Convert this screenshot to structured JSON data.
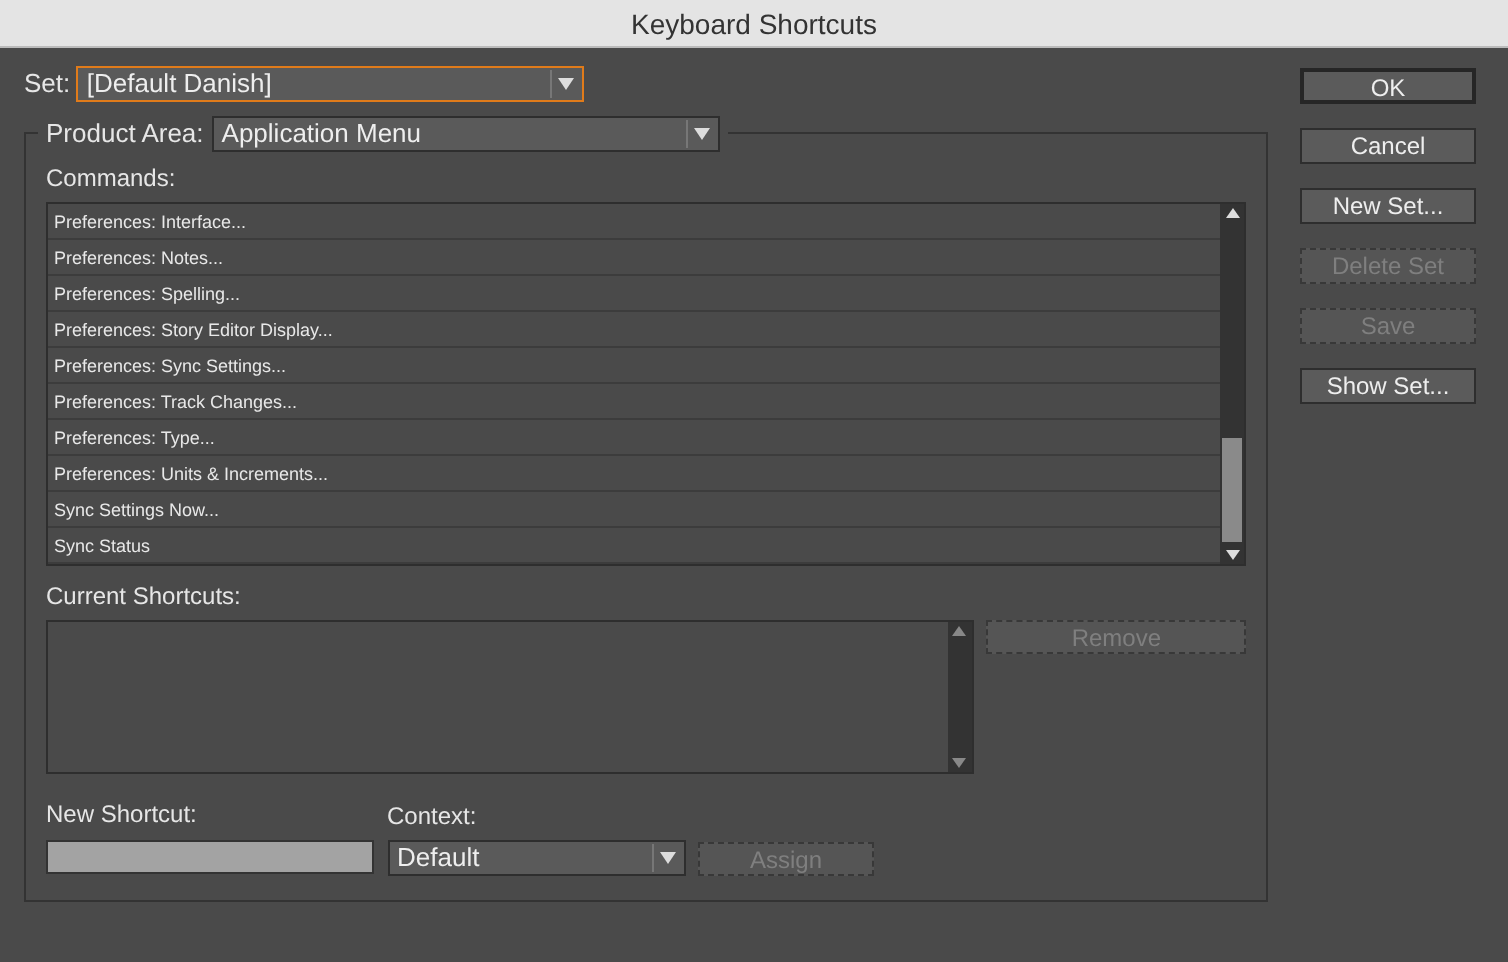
{
  "window": {
    "title": "Keyboard Shortcuts"
  },
  "set": {
    "label": "Set:",
    "value": "[Default Danish]",
    "focused": true
  },
  "product_area": {
    "label": "Product Area:",
    "value": "Application Menu"
  },
  "commands": {
    "label": "Commands:",
    "items": [
      {
        "text": "Preferences: Interface...",
        "selected": false
      },
      {
        "text": "Preferences: Notes...",
        "selected": false
      },
      {
        "text": "Preferences: Spelling...",
        "selected": false
      },
      {
        "text": "Preferences: Story Editor Display...",
        "selected": false
      },
      {
        "text": "Preferences: Sync Settings...",
        "selected": false
      },
      {
        "text": "Preferences: Track Changes...",
        "selected": false
      },
      {
        "text": "Preferences: Type...",
        "selected": false
      },
      {
        "text": "Preferences: Units & Increments...",
        "selected": false
      },
      {
        "text": "Sync Settings Now...",
        "selected": false
      },
      {
        "text": "Sync Status",
        "selected": false
      }
    ]
  },
  "current_shortcuts": {
    "label": "Current Shortcuts:",
    "remove_button": {
      "label": "Remove",
      "disabled": true
    }
  },
  "new_shortcut": {
    "label": "New Shortcut:"
  },
  "context": {
    "label": "Context:",
    "value": "Default"
  },
  "assign_button": {
    "label": "Assign",
    "disabled": true
  },
  "buttons": [
    {
      "label": "OK",
      "disabled": false,
      "default": true
    },
    {
      "label": "Cancel",
      "disabled": false,
      "default": false
    },
    {
      "label": "New Set...",
      "disabled": false,
      "default": false
    },
    {
      "label": "Delete Set",
      "disabled": true,
      "default": false
    },
    {
      "label": "Save",
      "disabled": true,
      "default": false
    },
    {
      "label": "Show Set...",
      "disabled": false,
      "default": false
    }
  ]
}
